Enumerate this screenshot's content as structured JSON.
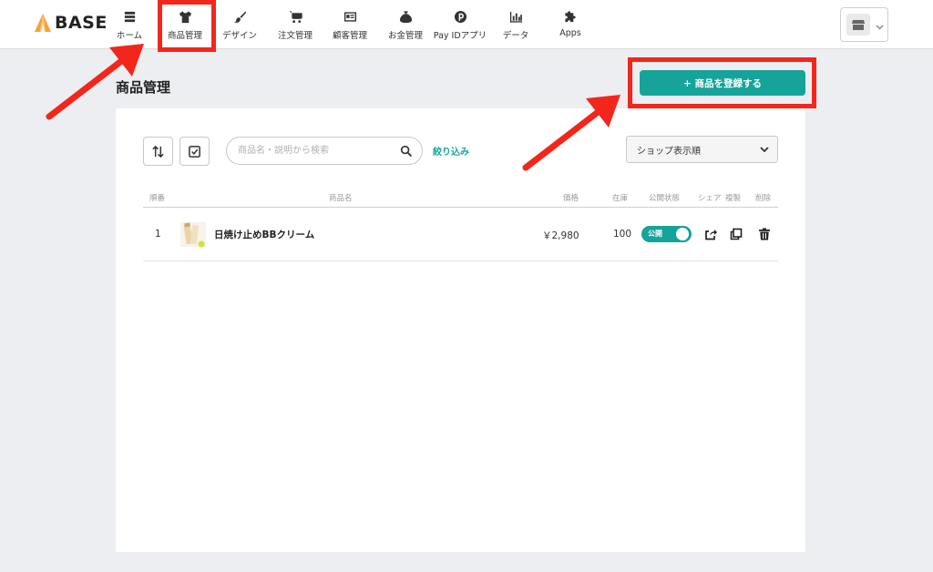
{
  "brand": {
    "name": "BASE"
  },
  "nav": {
    "items": [
      {
        "label": "ホーム",
        "icon": "list-icon"
      },
      {
        "label": "商品管理",
        "icon": "tshirt-icon"
      },
      {
        "label": "デザイン",
        "icon": "brush-icon"
      },
      {
        "label": "注文管理",
        "icon": "cart-icon"
      },
      {
        "label": "顧客管理",
        "icon": "id-card-icon"
      },
      {
        "label": "お金管理",
        "icon": "money-bag-icon"
      },
      {
        "label": "Pay IDアプリ",
        "icon": "payid-icon"
      },
      {
        "label": "データ",
        "icon": "bar-chart-icon"
      },
      {
        "label": "Apps",
        "icon": "puzzle-icon"
      }
    ]
  },
  "page": {
    "title": "商品管理",
    "register_button": "+ 商品を登録する"
  },
  "toolbar": {
    "search_placeholder": "商品名・説明から検索",
    "filter_label": "絞り込み",
    "sort_selected": "ショップ表示順"
  },
  "table": {
    "headers": {
      "order": "順番",
      "name": "商品名",
      "price": "価格",
      "stock": "在庫",
      "status": "公開状態",
      "share": "シェア",
      "duplicate": "複製",
      "delete": "削除"
    },
    "rows": [
      {
        "order": "1",
        "name": "日焼け止めBBクリーム",
        "price": "￥2,980",
        "stock": "100",
        "status": "公開",
        "published": true
      }
    ]
  },
  "colors": {
    "accent": "#15a39a",
    "annotation": "#f3261c",
    "background": "#eceef1"
  }
}
